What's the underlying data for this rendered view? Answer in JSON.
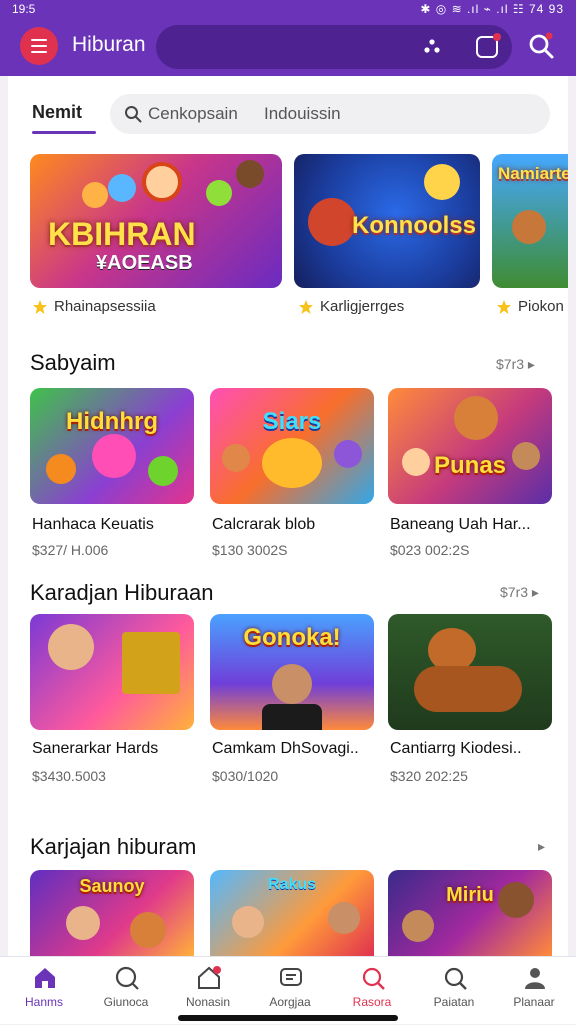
{
  "status_bar": {
    "time": "19:5",
    "icons": "✱ ◎ ≋ .ıl ⌁ .ıl ☷ 74 93"
  },
  "app_bar": {
    "title": "Hiburan"
  },
  "sub_header": {
    "active_tab": "Nemit",
    "search_placeholder": "Cenkopsain",
    "search_hint": "Indouissin"
  },
  "featured": [
    {
      "title_line1": "KBIHRAN",
      "title_line2": "¥AOEASB",
      "label": "Rhainapsessiia"
    },
    {
      "title_line1": "Konnoolss",
      "title_line2": "",
      "label": "Karligjerrges"
    },
    {
      "title_line1": "Namiarte",
      "title_line2": "",
      "label": "Piokon"
    }
  ],
  "sections": [
    {
      "title": "Sabyaim",
      "more": "$7r3",
      "cards": [
        {
          "art": "Hidnhrg",
          "name": "Hanhaca Keuatis",
          "price": "$327/ H.006"
        },
        {
          "art": "Siars",
          "name": "Calcrarak blob",
          "price": "$130 3002S"
        },
        {
          "art": "Punas",
          "name": "Baneang Uah Har...",
          "price": "$023 002:2S"
        }
      ]
    },
    {
      "title": "Karadjan Hiburaan",
      "more": "$7r3",
      "cards": [
        {
          "art": "",
          "name": "Sanerarkar Hards",
          "price": "$3430.5003"
        },
        {
          "art": "Gonoka!",
          "name": "Camkam DhSovagi..",
          "price": "$030/1020"
        },
        {
          "art": "",
          "name": "Cantiarrg Kiodesi..",
          "price": "$320 202:25"
        }
      ]
    },
    {
      "title": "Karjajan hiburam",
      "more": "",
      "cards": [
        {
          "art": "Saunoy",
          "name": "",
          "price": ""
        },
        {
          "art": "Rakus",
          "name": "",
          "price": ""
        },
        {
          "art": "Miriu",
          "name": "",
          "price": ""
        }
      ]
    }
  ],
  "bottom_nav": [
    {
      "label": "Hanms",
      "icon": "home-icon",
      "active": true
    },
    {
      "label": "Giunoca",
      "icon": "search-circle-icon",
      "active": false
    },
    {
      "label": "Nonasin",
      "icon": "house-notification-icon",
      "active": false
    },
    {
      "label": "Aorgjaa",
      "icon": "chat-icon",
      "active": false
    },
    {
      "label": "Rasora",
      "icon": "search-red-icon",
      "active": false
    },
    {
      "label": "Paiatan",
      "icon": "search-icon",
      "active": false
    },
    {
      "label": "Planaar",
      "icon": "profile-icon",
      "active": false
    }
  ],
  "colors": {
    "brand": "#6a33b8",
    "accent": "#e0324f",
    "active_nav": "#6a33b8"
  }
}
